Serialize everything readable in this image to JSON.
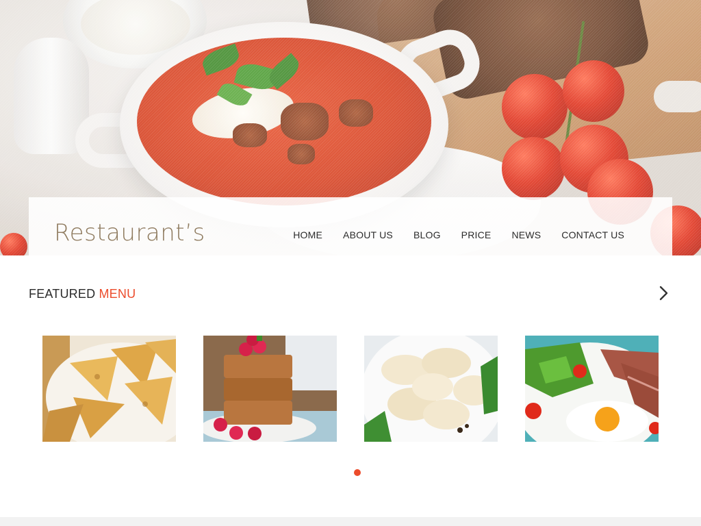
{
  "brand": {
    "logo_text": "Restaurant’s"
  },
  "nav": {
    "items": [
      {
        "label": "HOME"
      },
      {
        "label": "ABOUT US"
      },
      {
        "label": "BLOG"
      },
      {
        "label": "PRICE"
      },
      {
        "label": "NEWS"
      },
      {
        "label": "CONTACT US"
      }
    ]
  },
  "hero": {
    "image_icon": "soup-hero-photo"
  },
  "featured": {
    "title_main": "FEATURED",
    "title_accent": "MENU",
    "next_icon": "chevron-right-icon",
    "cards": [
      {
        "image": "crepes-photo"
      },
      {
        "image": "raspberry-cake-photo"
      },
      {
        "image": "dumplings-photo"
      },
      {
        "image": "steak-egg-salad-photo"
      }
    ],
    "pagination": {
      "total": 1,
      "active": 1
    }
  },
  "colors": {
    "accent": "#ec4c2c",
    "logo": "#8e7a5e",
    "text": "#2b2b2b"
  }
}
